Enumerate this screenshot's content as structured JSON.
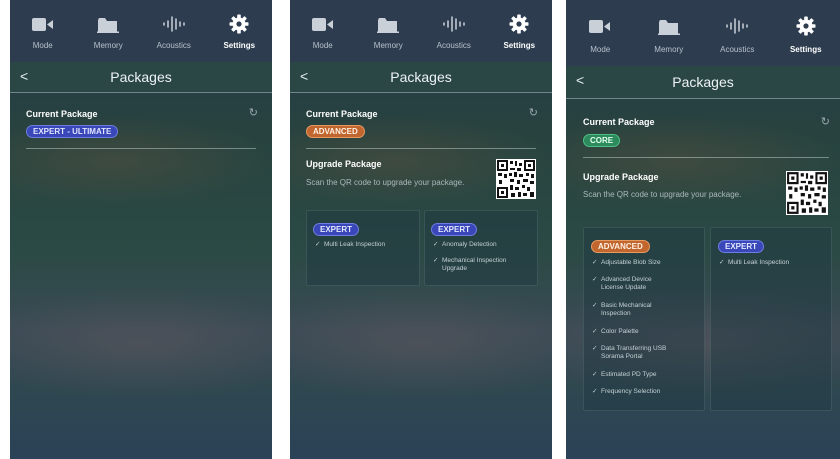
{
  "tabs": [
    "Mode",
    "Memory",
    "Acoustics",
    "Settings"
  ],
  "header": {
    "back": "<",
    "title": "Packages"
  },
  "current_label": "Current Package",
  "upgrade_label": "Upgrade Package",
  "upgrade_hint": "Scan the QR code to upgrade your package.",
  "screens": [
    {
      "current_package": "EXPERT - ULTIMATE"
    },
    {
      "current_package": "ADVANCED",
      "cards": [
        {
          "badge": "EXPERT",
          "features": [
            "Multi Leak Inspection"
          ]
        },
        {
          "badge": "EXPERT",
          "features": [
            "Anomaly Detection",
            "Mechanical Inspection Upgrade"
          ]
        }
      ]
    },
    {
      "current_package": "CORE",
      "cards": [
        {
          "badge": "ADVANCED",
          "features": [
            "Adjustable Blob Size",
            "Advanced Device License Update",
            "Basic Mechanical Inspection",
            "Color Palette",
            "Data Transferring USB Sorama Portal",
            "Estimated PD Type",
            "Frequency Selection"
          ]
        },
        {
          "badge": "EXPERT",
          "features": [
            "Multi Leak Inspection"
          ]
        }
      ]
    }
  ],
  "colors": {
    "ultimate": "#3a47b8",
    "advanced": "#c0662e",
    "core": "#2c8a5c",
    "expert": "#3a47b8"
  },
  "icons": [
    "video-camera-icon",
    "folder-icon",
    "sound-wave-icon",
    "gear-icon",
    "refresh-icon",
    "check-icon",
    "qr-code-icon"
  ]
}
